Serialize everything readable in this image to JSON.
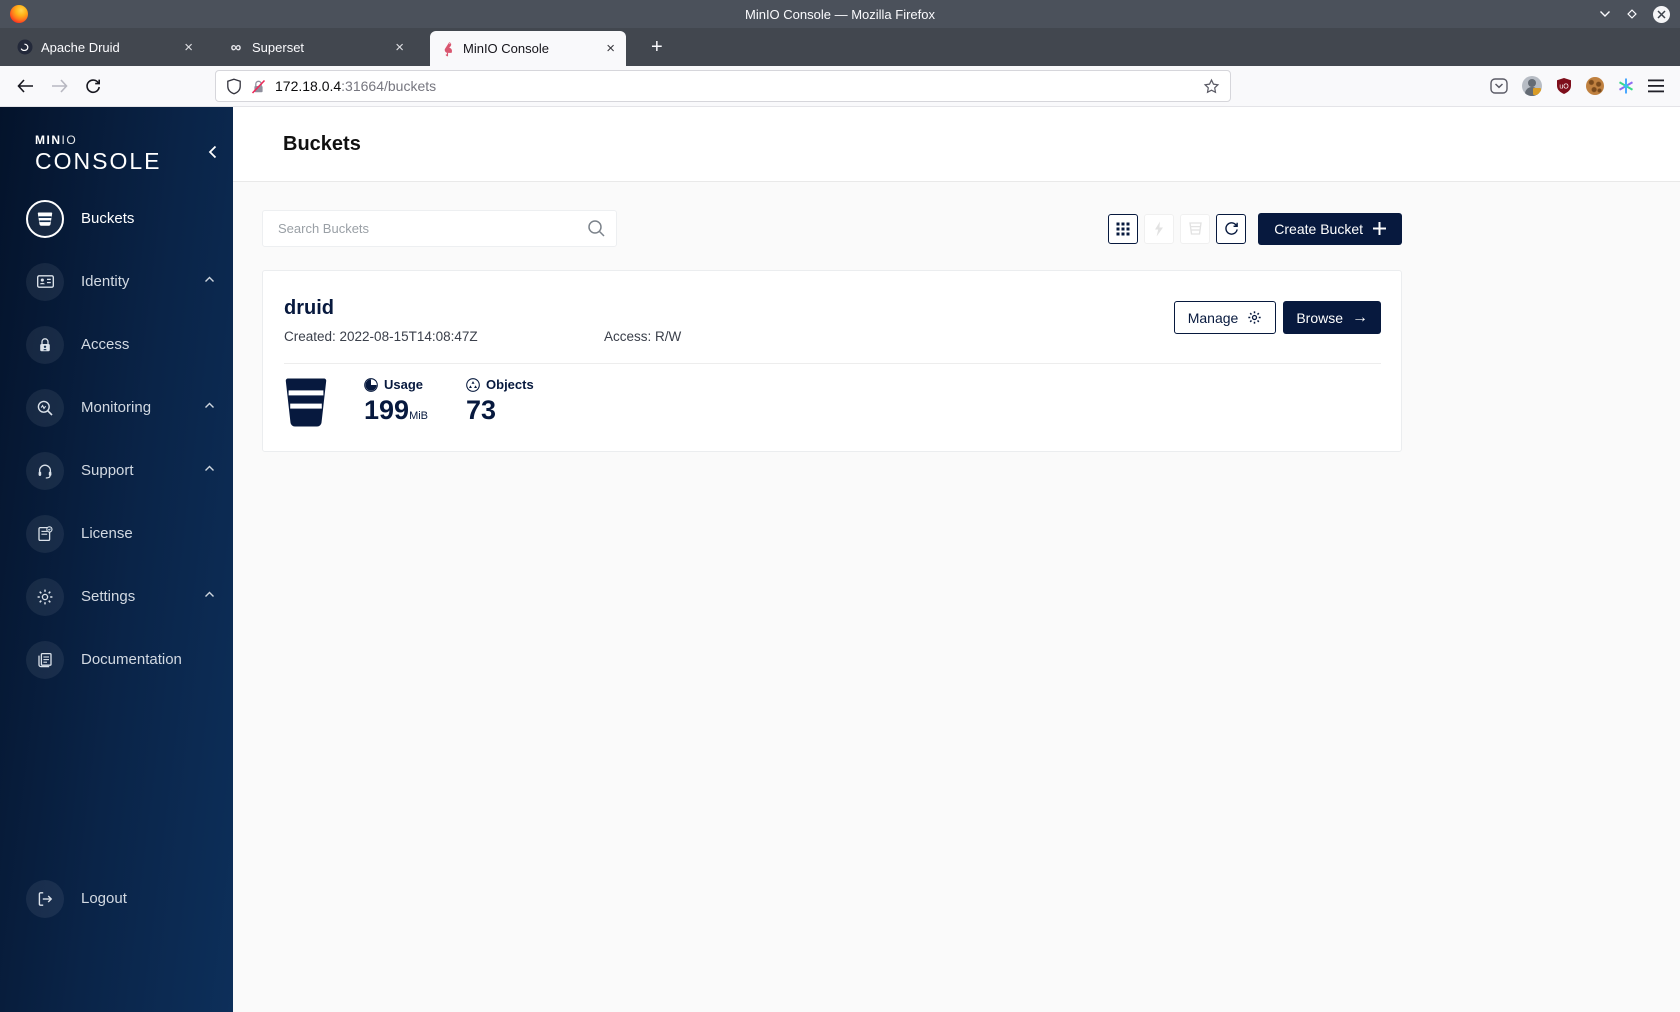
{
  "browser": {
    "window_title": "MinIO Console — Mozilla Firefox",
    "tabs": [
      {
        "label": "Apache Druid"
      },
      {
        "label": "Superset"
      },
      {
        "label": "MinIO Console"
      }
    ],
    "url_host": "172.18.0.4",
    "url_rest": ":31664/buckets"
  },
  "icons": {
    "close_tab": "×",
    "new_tab": "+",
    "superset_glyph": "∞",
    "browse_arrow": "→",
    "ublock_badge": "uO"
  },
  "sidebar": {
    "brand_min": "MIN",
    "brand_io": "IO",
    "brand_console": "CONSOLE",
    "items": [
      {
        "label": "Buckets"
      },
      {
        "label": "Identity"
      },
      {
        "label": "Access"
      },
      {
        "label": "Monitoring"
      },
      {
        "label": "Support"
      },
      {
        "label": "License"
      },
      {
        "label": "Settings"
      },
      {
        "label": "Documentation"
      }
    ],
    "logout_label": "Logout"
  },
  "page": {
    "title": "Buckets",
    "search_placeholder": "Search Buckets",
    "create_bucket_label": "Create Bucket",
    "bucket": {
      "name": "druid",
      "created": "Created: 2022-08-15T14:08:47Z",
      "access": "Access: R/W",
      "usage_label": "Usage",
      "usage_value": "199",
      "usage_unit": "MiB",
      "objects_label": "Objects",
      "objects_value": "73",
      "manage_label": "Manage",
      "browse_label": "Browse"
    }
  },
  "colors": {
    "accent_navy": "#07193E",
    "sidebar_gradient_start": "#04132b",
    "sidebar_gradient_end": "#0d2f5a",
    "titlebar": "#4b515b"
  }
}
